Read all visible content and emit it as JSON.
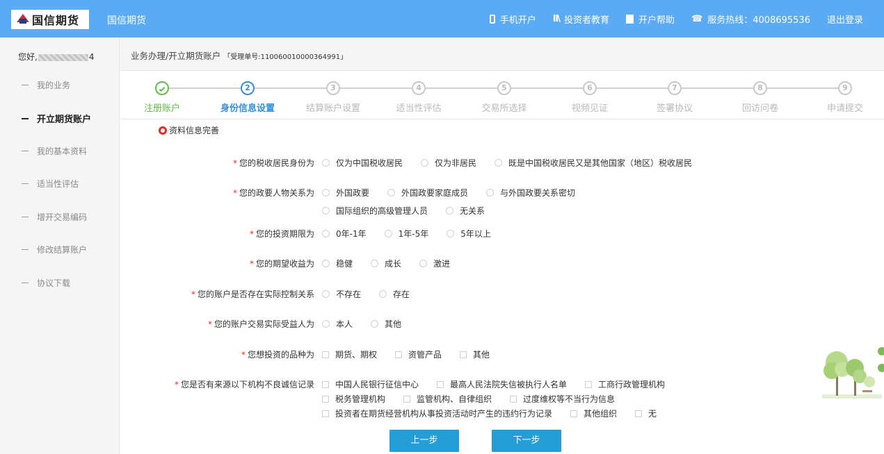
{
  "header": {
    "logo_text": "国信期货",
    "brand": "国信期货",
    "nav": [
      {
        "icon": "mobile-phone-icon",
        "label": "手机开户"
      },
      {
        "icon": "books-icon",
        "label": "投资者教育"
      },
      {
        "icon": "bookmark-icon",
        "label": "开户帮助"
      },
      {
        "icon": "telephone-icon",
        "label": "服务热线：4008695536"
      },
      {
        "icon": "",
        "label": "退出登录"
      }
    ]
  },
  "sidebar": {
    "greeting_prefix": "您好,",
    "greeting_suffix": "4",
    "items": [
      "我的业务",
      "开立期货账户",
      "我的基本资料",
      "适当性评估",
      "增开交易编码",
      "修改结算账户",
      "协议下载"
    ],
    "active_index": 1
  },
  "breadcrumb": {
    "path": "业务办理/开立期货账户",
    "serial": "「受理单号:110060010000364991」"
  },
  "steps": {
    "items": [
      {
        "num": "1",
        "label": "注册账户",
        "state": "done"
      },
      {
        "num": "2",
        "label": "身份信息设置",
        "state": "current"
      },
      {
        "num": "3",
        "label": "结算账户设置",
        "state": "todo"
      },
      {
        "num": "4",
        "label": "适当性评估",
        "state": "todo"
      },
      {
        "num": "5",
        "label": "交易所选择",
        "state": "todo"
      },
      {
        "num": "6",
        "label": "视频见证",
        "state": "todo"
      },
      {
        "num": "7",
        "label": "签署协议",
        "state": "todo"
      },
      {
        "num": "8",
        "label": "回访问卷",
        "state": "todo"
      },
      {
        "num": "9",
        "label": "申请提交",
        "state": "todo"
      }
    ]
  },
  "form": {
    "section_title": "资料信息完善",
    "required_mark": "*",
    "questions": [
      {
        "label": "您的税收居民身份为",
        "type": "radio",
        "lines": [
          [
            "仅为中国税收居民",
            "仅为非居民",
            "既是中国税收居民又是其他国家（地区）税收居民"
          ]
        ]
      },
      {
        "label": "您的政要人物关系为",
        "type": "radio",
        "lines": [
          [
            "外国政要",
            "外国政要家庭成员",
            "与外国政要关系密切"
          ],
          [
            "国际组织的高级管理人员",
            "无关系"
          ]
        ]
      },
      {
        "label": "您的投资期限为",
        "type": "radio",
        "lines": [
          [
            "0年-1年",
            "1年-5年",
            "5年以上"
          ]
        ]
      },
      {
        "label": "您的期望收益为",
        "type": "radio",
        "lines": [
          [
            "稳健",
            "成长",
            "激进"
          ]
        ]
      },
      {
        "label": "您的账户是否存在实际控制关系",
        "type": "radio",
        "lines": [
          [
            "不存在",
            "存在"
          ]
        ]
      },
      {
        "label": "您的账户交易实际受益人为",
        "type": "radio",
        "lines": [
          [
            "本人",
            "其他"
          ]
        ]
      },
      {
        "label": "您想投资的品种为",
        "type": "checkbox",
        "lines": [
          [
            "期货、期权",
            "资管产品",
            "其他"
          ]
        ]
      },
      {
        "label": "您是否有来源以下机构不良诚信记录",
        "type": "checkbox",
        "lines": [
          [
            "中国人民银行征信中心",
            "最高人民法院失信被执行人名单",
            "工商行政管理机构"
          ],
          [
            "税务管理机构",
            "监管机构、自律组织",
            "过度维权等不当行为信息"
          ],
          [
            "投资者在期货经营机构从事投资活动时产生的违约行为记录",
            "其他组织",
            "无"
          ]
        ]
      }
    ]
  },
  "buttons": {
    "prev": "上一步",
    "next": "下一步"
  },
  "colors": {
    "header": "#5aabf4",
    "done": "#62bb46",
    "current": "#2f8fe0",
    "button": "#259ed8",
    "required": "#e02d2d"
  }
}
